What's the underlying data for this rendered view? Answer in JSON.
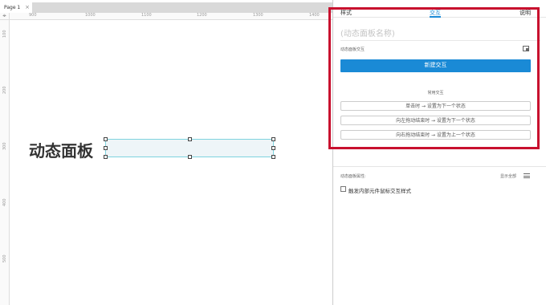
{
  "tabbar": {
    "page_tab": "Page 1",
    "close_glyph": "×"
  },
  "ruler": {
    "corner_glyph": "⌖",
    "top_labels": [
      "900",
      "1000",
      "1100",
      "1200",
      "1300",
      "1400"
    ],
    "left_labels": [
      "100",
      "200",
      "300",
      "400",
      "500"
    ]
  },
  "canvas": {
    "widget_text": "动态面板"
  },
  "panel": {
    "tabs": [
      "样式",
      "交互",
      "说明"
    ],
    "active_tab": "交互",
    "name_placeholder": "(动态面板名称)",
    "interactions_label": "动态面板交互",
    "new_interaction_button": "新建交互",
    "common_interactions_label": "常用交互",
    "common_interactions": [
      "单击时 → 设置为下一个状态",
      "向左拖动结束时 → 设置为下一个状态",
      "向右拖动结束时 → 设置为上一个状态"
    ],
    "properties_label": "动态面板属性:",
    "show_all_label": "显示全部",
    "checkbox_label": "触发内部元件鼠标交互样式",
    "checkbox_checked": false
  },
  "colors": {
    "accent": "#1a8ad6",
    "highlight_frame": "#c8102e",
    "panel_fill": "#eef5f8",
    "panel_border": "#7fd3df"
  },
  "icons": {
    "expand": "expand-icon",
    "menu": "menu-icon"
  }
}
